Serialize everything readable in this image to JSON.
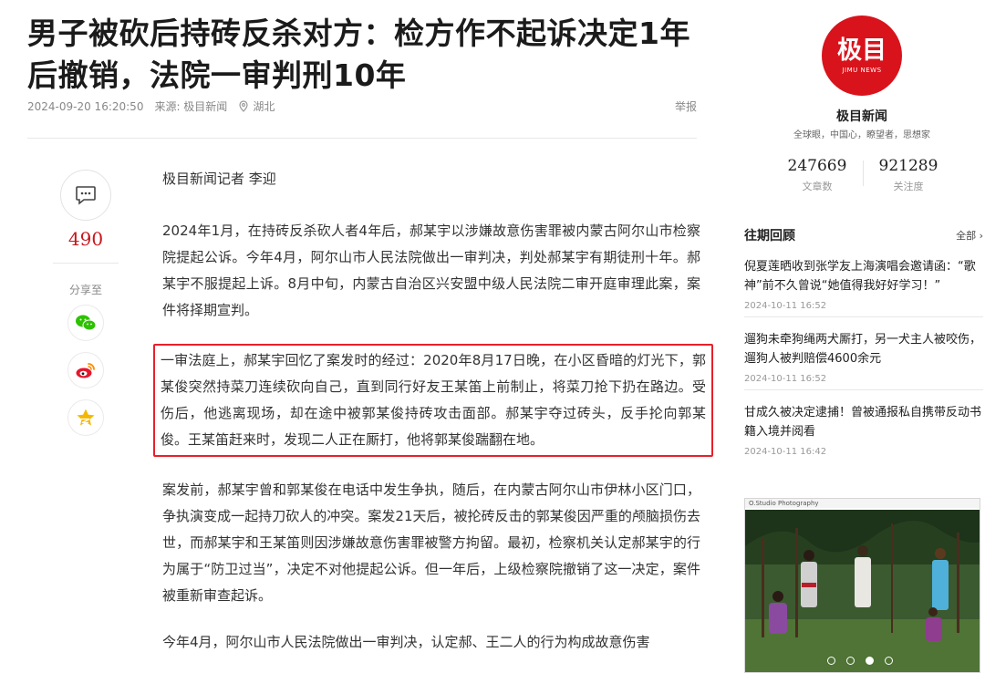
{
  "article": {
    "title": "男子被砍后持砖反杀对方：检方作不起诉决定1年后撤销，法院一审判刑10年",
    "datetime": "2024-09-20 16:20:50",
    "source": "来源: 极目新闻",
    "location": "湖北",
    "report_label": "举报",
    "byline": "极目新闻记者 李迎",
    "paragraphs": [
      "2024年1月，在持砖反杀砍人者4年后，郝某宇以涉嫌故意伤害罪被内蒙古阿尔山市检察院提起公诉。今年4月，阿尔山市人民法院做出一审判决，判处郝某宇有期徒刑十年。郝某宇不服提起上诉。8月中旬，内蒙古自治区兴安盟中级人民法院二审开庭审理此案，案件将择期宣判。",
      "一审法庭上，郝某宇回忆了案发时的经过：2020年8月17日晚，在小区昏暗的灯光下，郭某俊突然持菜刀连续砍向自己，直到同行好友王某笛上前制止，将菜刀抢下扔在路边。受伤后，他逃离现场，却在途中被郭某俊持砖攻击面部。郝某宇夺过砖头，反手抡向郭某俊。王某笛赶来时，发现二人正在厮打，他将郭某俊踹翻在地。",
      "案发前，郝某宇曾和郭某俊在电话中发生争执，随后，在内蒙古阿尔山市伊林小区门口，争执演变成一起持刀砍人的冲突。案发21天后，被抡砖反击的郭某俊因严重的颅脑损伤去世，而郝某宇和王某笛则因涉嫌故意伤害罪被警方拘留。最初，检察机关认定郝某宇的行为属于“防卫过当”，决定不对他提起公诉。但一年后，上级检察院撤销了这一决定，案件被重新审查起诉。",
      "今年4月，阿尔山市人民法院做出一审判决，认定郝、王二人的行为构成故意伤害"
    ]
  },
  "left": {
    "comment_count": "490",
    "share_label": "分享至"
  },
  "sidebar": {
    "logo_text": "极目",
    "logo_sub": "JIMU NEWS",
    "source_name": "极目新闻",
    "tagline": "全球眼，中国心，瞭望者，思想家",
    "stats": [
      {
        "value": "247669",
        "label": "文章数"
      },
      {
        "value": "921289",
        "label": "关注度"
      }
    ],
    "past_title": "往期回顾",
    "past_all": "全部 ›",
    "past_items": [
      {
        "title": "倪夏莲晒收到张学友上海演唱会邀请函：“歌神”前不久曾说“她值得我好好学习！”",
        "date": "2024-10-11 16:52"
      },
      {
        "title": "遛狗未牵狗绳两犬厮打，另一犬主人被咬伤，遛狗人被判赔偿4600余元",
        "date": "2024-10-11 16:52"
      },
      {
        "title": "甘成久被决定逮捕！曾被通报私自携带反动书籍入境并阅看",
        "date": "2024-10-11 16:42"
      }
    ],
    "gallery_caption": "O.Studio Photography"
  },
  "colors": {
    "brand_red": "#d8131c",
    "highlight_border": "#e8202a"
  }
}
